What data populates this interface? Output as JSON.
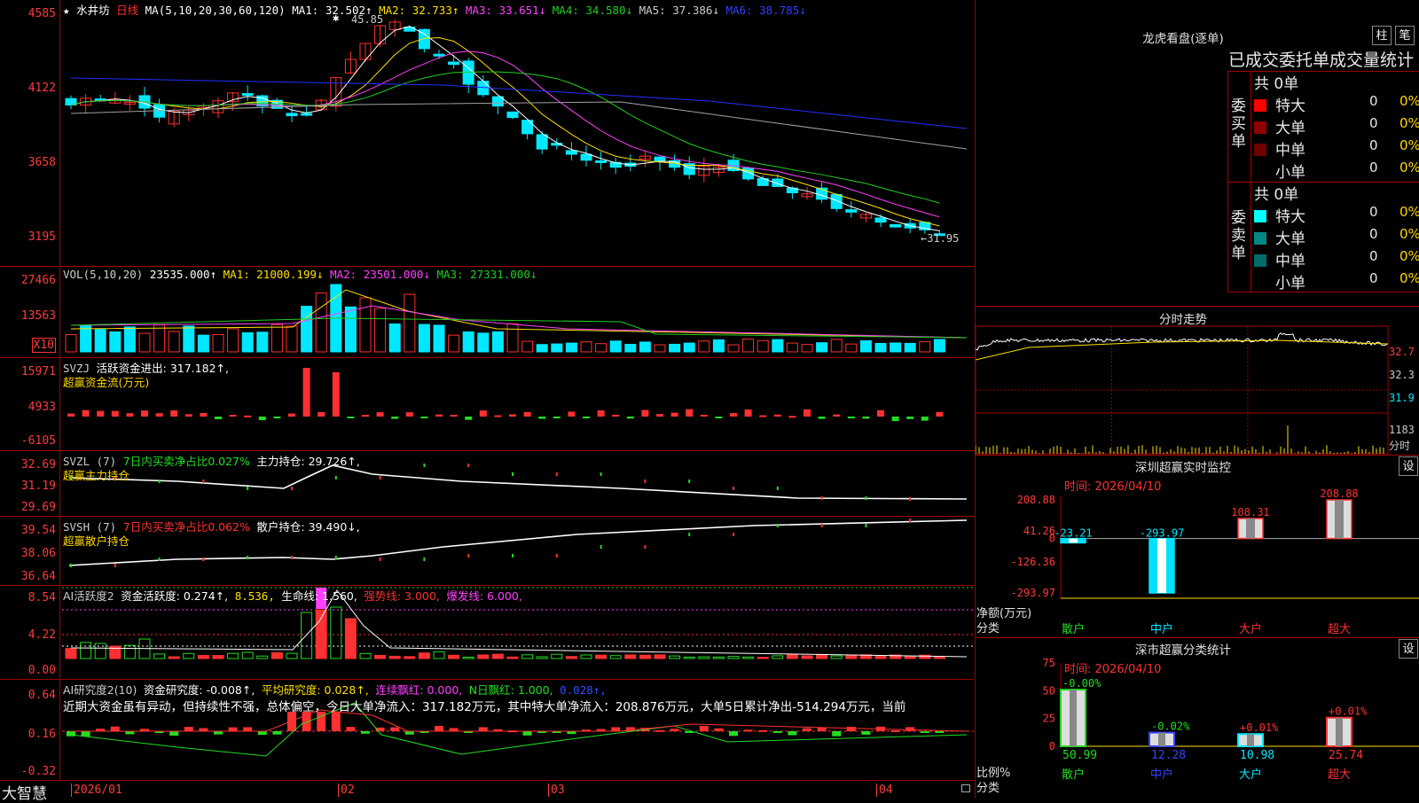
{
  "app": {
    "brand": "大智慧",
    "stock": "水井坊",
    "period": "日线"
  },
  "colors": {
    "up": "#ff3030",
    "down": "#00e8ff",
    "ma1": "#ffffff",
    "ma2": "#ffe000",
    "ma3": "#ff40ff",
    "ma4": "#22cc22",
    "ma5": "#a0a0a0",
    "ma6": "#2030ff",
    "green": "#22dd22",
    "yellow": "#ffd700",
    "frame": "#a00000"
  },
  "price_pane": {
    "y_labels": [
      "4585",
      "4122",
      "3658",
      "3195"
    ],
    "legend": {
      "prefix": "MA(5,10,20,30,60,120)",
      "ma1": "MA1: 32.502↑",
      "ma2": "MA2: 32.733↑",
      "ma3": "MA3: 33.651↓",
      "ma4": "MA4: 34.580↓",
      "ma5": "MA5: 37.386↓",
      "ma6": "MA6: 38.785↓"
    },
    "high_note": "45.85",
    "low_note": "←31.95"
  },
  "vol_pane": {
    "y_labels": [
      "27466",
      "13563"
    ],
    "x10": "X10",
    "legend": {
      "prefix": "VOL(5,10,20)",
      "val": "23535.000↑",
      "ma1": "MA1: 21000.199↓",
      "ma2": "MA2: 23501.000↓",
      "ma3": "MA3: 27331.000↓"
    }
  },
  "svzj_pane": {
    "y_labels": [
      "15971",
      "4933",
      "-6105"
    ],
    "line1_a": "SVZJ",
    "line1_b": "活跃资金进出: 317.182↑,",
    "line2": "超赢资金流(万元)"
  },
  "svzl_pane": {
    "y_labels": [
      "32.69",
      "31.19",
      "29.69"
    ],
    "a": "SVZL (7)",
    "b": "7日内买卖净占比0.027%",
    "c": "主力持仓: 29.726↑,",
    "line2": "超赢主力持仓"
  },
  "svsh_pane": {
    "y_labels": [
      "39.54",
      "38.06",
      "36.64"
    ],
    "a": "SVSH (7)",
    "b": "7日内买卖净占比0.062%",
    "c": "散户持仓: 39.490↓,",
    "line2": "超赢散户持仓"
  },
  "ai1_pane": {
    "y_labels": [
      "8.54",
      "4.22",
      "0.00"
    ],
    "a": "AI活跃度2",
    "b": "资金活跃度: 0.274↑,",
    "c": "8.536,",
    "d": "生命线: 1.560,",
    "e": "强势线: 3.000,",
    "f": "爆发线: 6.000,"
  },
  "ai2_pane": {
    "y_labels": [
      "0.64",
      "0.16",
      "-0.32"
    ],
    "a": "AI研究度2(10)",
    "b": "资金研究度: -0.008↑,",
    "c": "平均研究度: 0.028↑,",
    "d": "连续飘红: 0.000,",
    "e": "N日飘红: 1.000,",
    "f": "0.028↑,",
    "comment": "近期大资金虽有异动，但持续性不强，总体偏空，今日大单净流入：317.182万元，其中特大单净流入：208.876万元，大单5日累计净出-514.294万元，当前"
  },
  "x_axis": {
    "labels": [
      "2026/01",
      "02",
      "03",
      "04"
    ]
  },
  "dragon": {
    "title": "龙虎看盘(逐单)",
    "btn1": "柱",
    "btn2": "笔",
    "subtitle": "已成交委托单成交量统计",
    "buy": {
      "side": "委买单",
      "total": "共 0单",
      "rows": [
        {
          "label": "特大",
          "v": "0",
          "p": "0%"
        },
        {
          "label": "大单",
          "v": "0",
          "p": "0%"
        },
        {
          "label": "中单",
          "v": "0",
          "p": "0%"
        },
        {
          "label": "小单",
          "v": "0",
          "p": "0%"
        }
      ]
    },
    "sell": {
      "side": "委卖单",
      "total": "共 0单",
      "rows": [
        {
          "label": "特大",
          "v": "0",
          "p": "0%"
        },
        {
          "label": "大单",
          "v": "0",
          "p": "0%"
        },
        {
          "label": "中单",
          "v": "0",
          "p": "0%"
        },
        {
          "label": "小单",
          "v": "0",
          "p": "0%"
        }
      ]
    }
  },
  "intraday": {
    "title": "分时走势",
    "y_labels": [
      "32.7",
      "32.3",
      "31.9"
    ],
    "vol_labels": [
      "1183",
      "分时"
    ]
  },
  "monitor": {
    "title": "深圳超赢实时监控",
    "btn": "设",
    "date": "时间: 2026/04/10",
    "y_labels": [
      "208.88",
      "41.26",
      "0",
      "-126.36",
      "-293.97"
    ],
    "ylabel": "净额(万元)",
    "xlabel": "分类",
    "cats": [
      "散户",
      "中户",
      "大户",
      "超大"
    ]
  },
  "chart_data": [
    {
      "type": "bar",
      "title": "深圳超赢实时监控",
      "ylabel": "净额(万元)",
      "xlabel": "分类",
      "categories": [
        "散户",
        "中户",
        "大户",
        "超大"
      ],
      "values": [
        -23.21,
        -293.97,
        108.31,
        208.88
      ],
      "value_labels": [
        "-23.21",
        "-293.97",
        "108.31",
        "208.88"
      ],
      "ylim": [
        -293.97,
        208.88
      ]
    },
    {
      "type": "bar",
      "title": "深市超赢分类统计",
      "ylabel": "比例%",
      "xlabel": "分类",
      "categories": [
        "散户",
        "中户",
        "大户",
        "超大"
      ],
      "values": [
        50.99,
        12.28,
        10.98,
        25.74
      ],
      "changes": [
        "-0.00%",
        "-0.02%",
        "+0.01%",
        "+0.01%"
      ],
      "ylim": [
        0,
        75
      ]
    }
  ],
  "classify": {
    "title": "深市超赢分类统计",
    "btn": "设",
    "date": "时间: 2026/04/10",
    "y_labels": [
      "75",
      "50",
      "25",
      "0"
    ],
    "ylabel": "比例%",
    "xlabel": "分类",
    "cats": [
      "散户",
      "中户",
      "大户",
      "超大"
    ],
    "vals": [
      "50.99",
      "12.28",
      "10.98",
      "25.74"
    ]
  }
}
